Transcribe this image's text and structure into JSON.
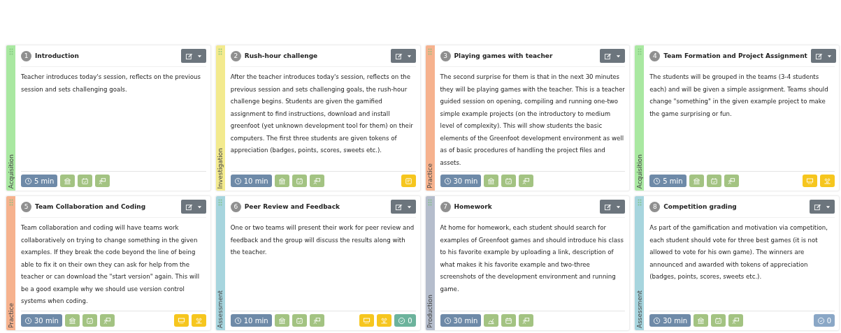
{
  "cards": [
    {
      "number": "1",
      "title": "Introduction",
      "phase": {
        "label": "Acquisition",
        "color": "#a9e8a1"
      },
      "description": "Teacher introduces today's session, reflects on the previous session and sets challenging goals.",
      "time": "5 min",
      "tags": [
        {
          "kind": "institution"
        },
        {
          "kind": "calendar-check"
        },
        {
          "kind": "presenter"
        }
      ]
    },
    {
      "number": "2",
      "title": "Rush-hour challenge",
      "phase": {
        "label": "Investigation",
        "color": "#f3ea8e"
      },
      "description": "After the teacher introduces today's session, reflects on the previous session and sets challenging goals, the rush-hour challenge begins. Students are given the gamified assignment to find instructions, download and install greenfoot (yet unknown development tool for them) on their computers. The first three students are given tokens of appreciation (badges, points, scores, sweets etc.).",
      "time": "10 min",
      "tags": [
        {
          "kind": "institution"
        },
        {
          "kind": "calendar-check"
        },
        {
          "kind": "presenter"
        }
      ],
      "extras": [
        {
          "kind": "note"
        }
      ]
    },
    {
      "number": "3",
      "title": "Playing games with teacher",
      "phase": {
        "label": "Practice",
        "color": "#f6b28e"
      },
      "description": "The second surprise for them is that in the next 30 minutes they will be playing games with the teacher. This is a teacher guided session on opening, compiling and running one-two simple example projects (on the introductory to medium level of complexity). This will show students the basic elements of the Greenfoot development environment as well as of basic procedures of handling the project files and assets.",
      "time": "30 min",
      "tags": [
        {
          "kind": "institution"
        },
        {
          "kind": "calendar-check"
        },
        {
          "kind": "presenter"
        }
      ]
    },
    {
      "number": "4",
      "title": "Team Formation and Project Assignment",
      "phase": {
        "label": "Acquisition",
        "color": "#a9e8a1"
      },
      "description": "The students will be grouped in the teams (3-4 students each) and will be given a simple assignment. Teams should change \"something\" in the given example project to make the game surprising or fun.",
      "time": "5 min",
      "tags": [
        {
          "kind": "institution"
        },
        {
          "kind": "calendar-check"
        },
        {
          "kind": "presenter"
        }
      ],
      "extras": [
        {
          "kind": "board"
        },
        {
          "kind": "group"
        }
      ]
    },
    {
      "number": "5",
      "title": "Team Collaboration and Coding",
      "phase": {
        "label": "Practice",
        "color": "#f6b28e"
      },
      "description": "Team collaboration and coding will have teams work collaboratively on trying to change something in the given examples. If they break the code beyond the line of being able to fix it on their own they can ask for help from the teacher or can download the \"start version\" again. This will be a good example why we should use version control systems when coding.",
      "time": "30 min",
      "tags": [
        {
          "kind": "institution"
        },
        {
          "kind": "calendar-check"
        },
        {
          "kind": "presenter"
        }
      ],
      "extras": [
        {
          "kind": "board"
        },
        {
          "kind": "group"
        }
      ]
    },
    {
      "number": "6",
      "title": "Peer Review and Feedback",
      "phase": {
        "label": "Assessment",
        "color": "#a7d5de"
      },
      "description": "One or two teams will present their work for peer review and feedback and the group will discuss the results along with the teacher.",
      "time": "10 min",
      "tags": [
        {
          "kind": "institution"
        },
        {
          "kind": "calendar-check"
        },
        {
          "kind": "presenter"
        }
      ],
      "extras": [
        {
          "kind": "board"
        },
        {
          "kind": "group"
        },
        {
          "kind": "count",
          "text": "0",
          "color": "#6cb39c"
        }
      ]
    },
    {
      "number": "7",
      "title": "Homework",
      "phase": {
        "label": "Production",
        "color": "#b5bdcc"
      },
      "description": "At home for homework, each student should search for examples of Greenfoot games and should introduce his class to his favorite example by uploading a link, description of what makes it his favorite example and two-three screenshots of the development environment and running game.",
      "time": "30 min",
      "tags": [
        {
          "kind": "chart"
        },
        {
          "kind": "calendar"
        },
        {
          "kind": "presenter"
        }
      ]
    },
    {
      "number": "8",
      "title": "Competition grading",
      "phase": {
        "label": "Assessment",
        "color": "#a7d5de"
      },
      "description": "As part of the gamification and motivation via competition, each student should vote for three best games (it is not allowed to vote for his own game). The winners are announced and awarded with tokens of appreciation (badges, points, scores, sweets etc.).",
      "time": "30 min",
      "tags": [
        {
          "kind": "institution"
        },
        {
          "kind": "calendar-check"
        },
        {
          "kind": "presenter"
        }
      ],
      "extras": [
        {
          "kind": "count",
          "text": "0",
          "color": "#8aa7c6"
        }
      ]
    }
  ]
}
